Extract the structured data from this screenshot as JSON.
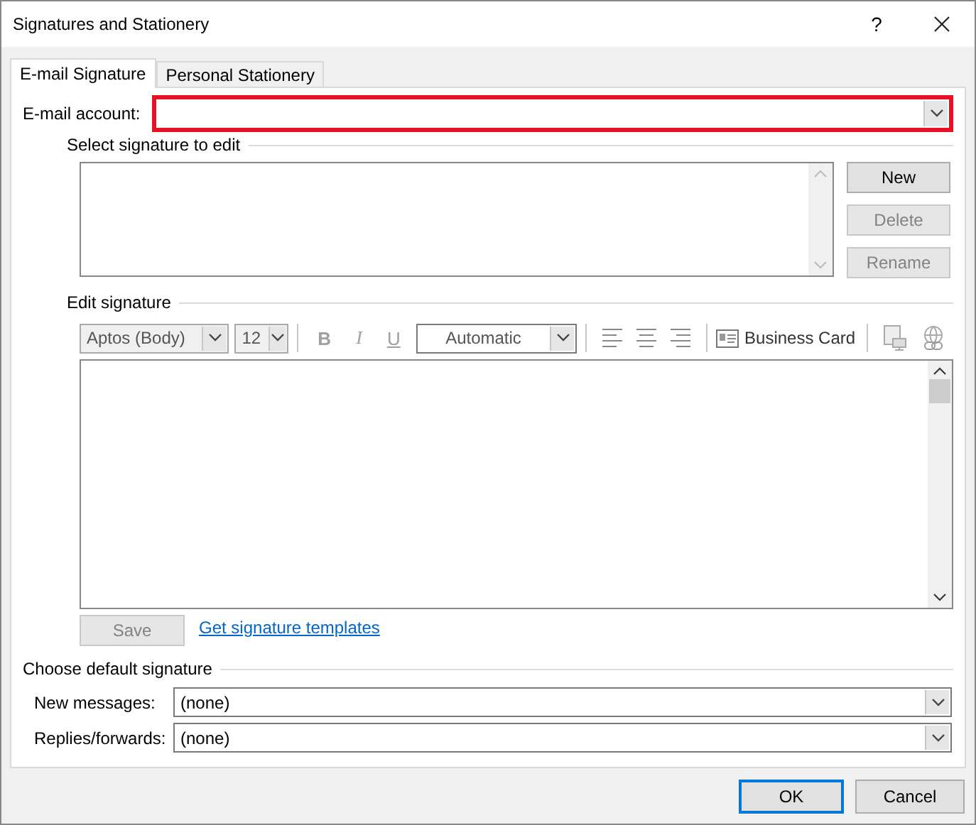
{
  "window": {
    "title": "Signatures and Stationery",
    "help": "?"
  },
  "tabs": [
    {
      "label": "E-mail Signature",
      "selected": true
    },
    {
      "label": "Personal Stationery",
      "selected": false
    }
  ],
  "email_account": {
    "label": "E-mail account:",
    "highlighted": true
  },
  "select_signature": {
    "heading": "Select signature to edit",
    "buttons": [
      {
        "label": "New",
        "disabled": false
      },
      {
        "label": "Delete",
        "disabled": true
      },
      {
        "label": "Rename",
        "disabled": true
      }
    ]
  },
  "edit_signature": {
    "heading": "Edit signature",
    "font": "Aptos (Body)",
    "size": "12",
    "format_buttons": [
      "B",
      "I",
      "U"
    ],
    "font_color_label": "Automatic",
    "business_card": "Business Card",
    "save": {
      "label": "Save",
      "disabled": true
    },
    "link": "Get signature templates"
  },
  "default_signature": {
    "heading": "Choose default signature",
    "fields": [
      {
        "label": "New messages:",
        "value": "(none)"
      },
      {
        "label": "Replies/forwards:",
        "value": "(none)"
      }
    ]
  },
  "buttons": [
    {
      "label": "OK",
      "default": true
    },
    {
      "label": "Cancel",
      "default": false
    }
  ]
}
